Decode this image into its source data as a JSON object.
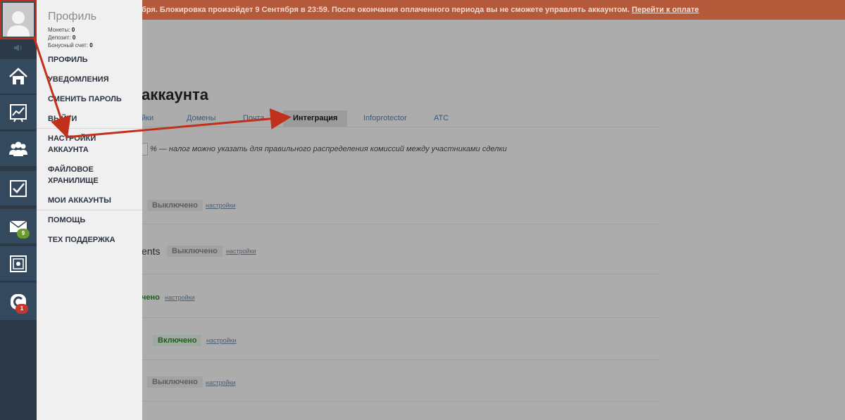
{
  "banner": {
    "text": "бря. Блокировка произойдет 9 Сентября в 23:59. После окончания оплаченного периода вы не сможете управлять аккаунтом.",
    "pay_link": "Перейти к оплате"
  },
  "main": {
    "title": "аккаунта",
    "tabs": [
      {
        "label": "йки"
      },
      {
        "label": "Домены"
      },
      {
        "label": "Почта"
      },
      {
        "label": "Интеграция"
      },
      {
        "label": "Infoprotector"
      },
      {
        "label": "АТС"
      }
    ],
    "tax_note": "% — налог можно указать для правильного распределения комиссий между участниками сделки",
    "rows": [
      {
        "status": "Выключено",
        "settings": "настройки"
      },
      {
        "label": "ents",
        "status": "Выключено",
        "settings": "настройки"
      },
      {
        "status": "чено",
        "settings": "настройки"
      },
      {
        "status": "Включено",
        "settings": "настройки"
      },
      {
        "status": "Выключено",
        "settings": "настройки"
      }
    ]
  },
  "sidebar": {
    "mail_badge": "9",
    "c_badge": "1",
    "icons": [
      "home-icon",
      "chart-icon",
      "users-icon",
      "checkbox-icon",
      "mail-icon",
      "safe-icon",
      "c-icon"
    ]
  },
  "menu": {
    "profile_title": "Профиль",
    "stats": [
      {
        "label": "Монеты:",
        "value": "0"
      },
      {
        "label": "Депозит:",
        "value": "0"
      },
      {
        "label": "Бонусный счет:",
        "value": "0"
      }
    ],
    "items": [
      {
        "label": "ПРОФИЛЬ"
      },
      {
        "label": "УВЕДОМЛЕНИЯ"
      },
      {
        "label": "СМЕНИТЬ ПАРОЛЬ"
      },
      {
        "label": "ВЫЙТИ"
      },
      {
        "label": "НАСТРОЙКИ АККАУНТА"
      },
      {
        "label": "ФАЙЛОВОЕ ХРАНИЛИЩЕ"
      },
      {
        "label": "МОИ АККАУНТЫ"
      },
      {
        "label": "ПОМОЩЬ"
      },
      {
        "label": "ТЕХ ПОДДЕРЖКА"
      }
    ]
  },
  "colors": {
    "banner": "#b45a3b",
    "sidebar": "#34495e",
    "arrow": "#c0301b",
    "mail_badge": "#6a9a2e",
    "c_badge": "#c0392b"
  }
}
